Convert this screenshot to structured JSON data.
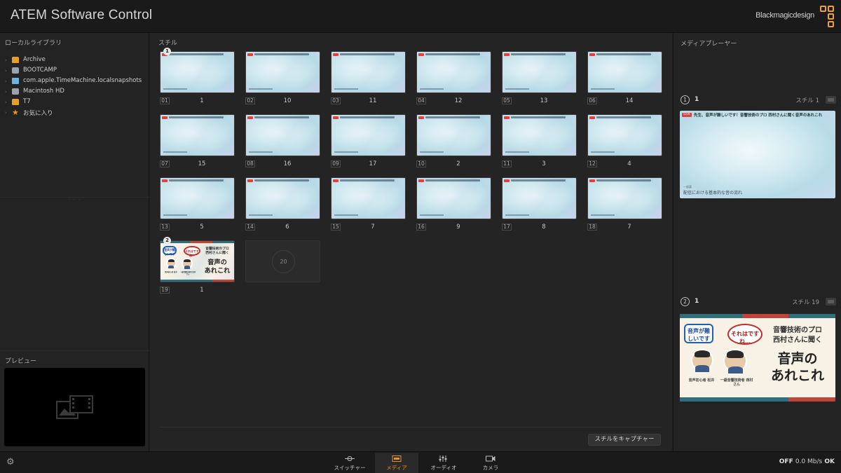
{
  "app": {
    "title": "ATEM Software Control",
    "brand": "Blackmagicdesign"
  },
  "left": {
    "library_title": "ローカルライブラリ",
    "tree": [
      {
        "label": "Archive",
        "icon": "drive-yellow-icon"
      },
      {
        "label": "BOOTCAMP",
        "icon": "drive-gray-icon"
      },
      {
        "label": "com.apple.TimeMachine.localsnapshots",
        "icon": "folder-icon"
      },
      {
        "label": "Macintosh HD",
        "icon": "drive-gray-icon"
      },
      {
        "label": "T7",
        "icon": "drive-yellow-icon"
      },
      {
        "label": "お気に入り",
        "icon": "star-icon"
      }
    ],
    "split_handle": "· · ·",
    "preview_title": "プレビュー"
  },
  "center": {
    "stills_title": "スチル",
    "slots": [
      {
        "num": "01",
        "name": "1",
        "badge": "1"
      },
      {
        "num": "02",
        "name": "10"
      },
      {
        "num": "03",
        "name": "11"
      },
      {
        "num": "04",
        "name": "12"
      },
      {
        "num": "05",
        "name": "13"
      },
      {
        "num": "06",
        "name": "14"
      },
      {
        "num": "07",
        "name": "15"
      },
      {
        "num": "08",
        "name": "16"
      },
      {
        "num": "09",
        "name": "17"
      },
      {
        "num": "10",
        "name": "2"
      },
      {
        "num": "11",
        "name": "3"
      },
      {
        "num": "12",
        "name": "4"
      },
      {
        "num": "13",
        "name": "5"
      },
      {
        "num": "14",
        "name": "6"
      },
      {
        "num": "15",
        "name": "7"
      },
      {
        "num": "16",
        "name": "9"
      },
      {
        "num": "17",
        "name": "8"
      },
      {
        "num": "18",
        "name": "7"
      },
      {
        "num": "19",
        "name": "1",
        "badge": "2",
        "kind": "card"
      }
    ],
    "empty_slot": "20",
    "capture_button": "スチルをキャプチャー"
  },
  "card_text": {
    "bubble1": "音声が難しいです",
    "bubble2": "それはですね…",
    "headline1": "音響技術のプロ",
    "headline2": "西村さんに聞く",
    "big1": "音声の",
    "big2": "あれこれ",
    "cap1": "音声初心者 松井",
    "cap2": "一級音響技術者 西村さん"
  },
  "right": {
    "title": "メディアプレーヤー",
    "players": [
      {
        "num": "1",
        "index": "1",
        "still": "スチル 1",
        "live": "Live",
        "headline": "先生、音声が難しいです！音響技術のプロ 西村さんに聞く音声のあれこれ",
        "foot1": "一般論",
        "foot2": "配信における基本的な音の流れ"
      },
      {
        "num": "2",
        "index": "1",
        "still": "スチル 19"
      }
    ]
  },
  "bottom": {
    "tabs": [
      {
        "label": "スイッチャー",
        "icon": "switcher-icon"
      },
      {
        "label": "メディア",
        "icon": "media-icon",
        "active": true
      },
      {
        "label": "オーディオ",
        "icon": "audio-icon"
      },
      {
        "label": "カメラ",
        "icon": "camera-icon"
      }
    ],
    "status_off": "OFF",
    "status_rate": "0.0 Mb/s",
    "status_ok": "OK"
  },
  "colors": {
    "accent": "#e8902c",
    "background": "#1f1f1f",
    "live": "#e04040"
  }
}
